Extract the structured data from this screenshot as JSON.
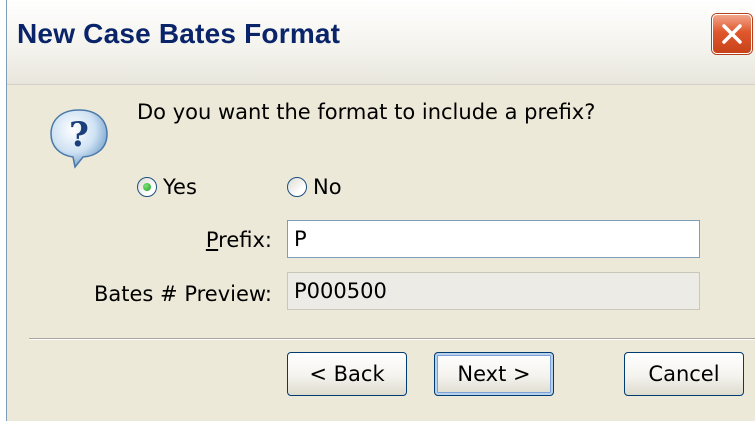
{
  "window": {
    "title": "New Case Bates Format",
    "close_icon": "close-x-icon"
  },
  "dialog": {
    "icon": "question-mark-icon",
    "question": "Do you want the format to include a prefix?",
    "radio_options": [
      {
        "label": "Yes",
        "selected": true
      },
      {
        "label": "No",
        "selected": false
      }
    ],
    "prefix_label_access_key": "P",
    "prefix_label_rest": "refix:",
    "prefix_value": "P",
    "preview_label": "Bates # Preview:",
    "preview_value": "P000500"
  },
  "buttons": {
    "back": "< Back",
    "next": "Next >",
    "cancel": "Cancel"
  },
  "colors": {
    "title_text": "#0a246a",
    "dialog_bg": "#ece9d8",
    "close_button": "#e0572c",
    "radio_selected": "#21a121"
  }
}
